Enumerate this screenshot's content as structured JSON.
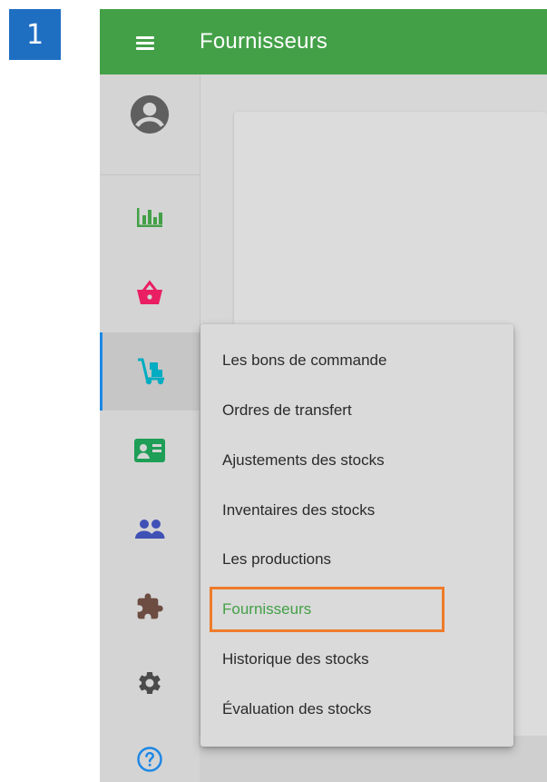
{
  "step": {
    "number": "1",
    "color": "#1e6fc2"
  },
  "header": {
    "title": "Fournisseurs",
    "color": "#43a047"
  },
  "sidebar": {
    "items": [
      {
        "name": "account",
        "icon": "account-circle-icon",
        "color": "#5f5f5f"
      },
      {
        "name": "reports",
        "icon": "bar-chart-icon",
        "color": "#43a047"
      },
      {
        "name": "sales",
        "icon": "basket-icon",
        "color": "#e91e63"
      },
      {
        "name": "inventory",
        "icon": "hand-truck-icon",
        "color": "#00acc1",
        "active": true
      },
      {
        "name": "customers",
        "icon": "id-card-icon",
        "color": "#1e9e57"
      },
      {
        "name": "employees",
        "icon": "people-icon",
        "color": "#3f51b5"
      },
      {
        "name": "integrations",
        "icon": "puzzle-icon",
        "color": "#6d4c41"
      },
      {
        "name": "settings",
        "icon": "gear-icon",
        "color": "#4b4b4b"
      },
      {
        "name": "help",
        "icon": "help-circle-icon",
        "color": "#1e88e5"
      }
    ]
  },
  "menu": {
    "items": [
      {
        "label": "Les bons de commande"
      },
      {
        "label": "Ordres de transfert"
      },
      {
        "label": "Ajustements des stocks"
      },
      {
        "label": "Inventaires des stocks"
      },
      {
        "label": "Les productions"
      },
      {
        "label": "Fournisseurs",
        "selected": true
      },
      {
        "label": "Historique des stocks"
      },
      {
        "label": "Évaluation des stocks"
      }
    ],
    "highlight_color": "#ef7b2a"
  }
}
